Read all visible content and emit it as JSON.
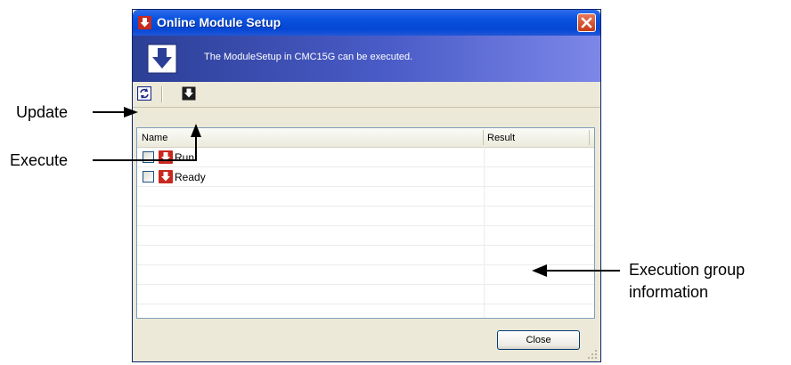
{
  "window": {
    "title": "Online Module Setup",
    "banner_text": "The ModuleSetup in CMC15G can be executed."
  },
  "toolbar": {
    "update_icon": "refresh-icon",
    "execute_icon": "execute-icon"
  },
  "list": {
    "columns": [
      "Name",
      "Result"
    ],
    "rows": [
      {
        "checked": false,
        "icon": "module-icon",
        "label": "Run",
        "result": ""
      },
      {
        "checked": false,
        "icon": "module-icon",
        "label": "Ready",
        "result": ""
      }
    ]
  },
  "buttons": {
    "close": "Close"
  },
  "callouts": {
    "update": "Update",
    "execute": "Execute",
    "group_line1": "Execution group",
    "group_line2": "information"
  },
  "colors": {
    "titlebar": "#0a53e0",
    "banner": "#4a5cc8",
    "icon_red": "#c8281e",
    "close_button": "#d8532f"
  }
}
